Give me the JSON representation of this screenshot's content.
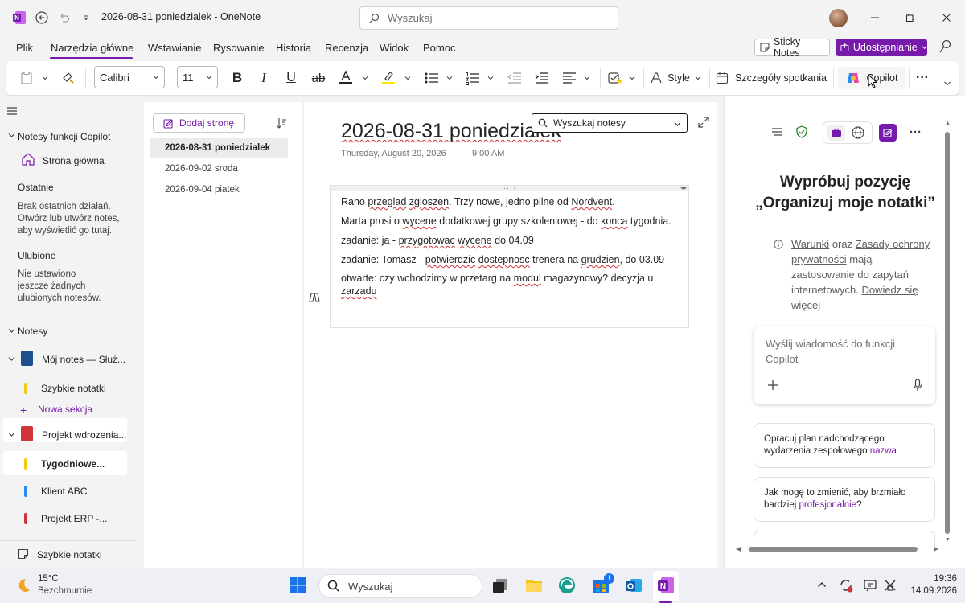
{
  "titlebar": {
    "doc_title": "2026-08-31 poniedzialek  -  OneNote",
    "search_placeholder": "Wyszukaj"
  },
  "menu": {
    "items": [
      "Plik",
      "Narzędzia główne",
      "Wstawianie",
      "Rysowanie",
      "Historia",
      "Recenzja",
      "Widok",
      "Pomoc"
    ],
    "active": "Narzędzia główne",
    "sticky_notes": "Sticky Notes",
    "share": "Udostępnianie"
  },
  "ribbon": {
    "font": "Calibri",
    "size": "11",
    "style_label": "Style",
    "meeting_details": "Szczegóły spotkania",
    "copilot": "Copilot",
    "more": "···"
  },
  "leftnav": {
    "copilot_notebooks": "Notesy funkcji Copilot",
    "home": "Strona główna",
    "recent_head": "Ostatnie",
    "recent_text": "Brak ostatnich działań. Otwórz lub utwórz notes, aby wyświetlić go tutaj.",
    "favorites_head": "Ulubione",
    "favorites_text": "Nie ustawiono jeszcze żadnych ulubionych notesów.",
    "notebooks_head": "Notesy",
    "notebook1": "Mój notes — Służ...",
    "section_quick": "Szybkie notatki",
    "new_section": "Nowa sekcja",
    "notebook2": "Projekt wdrozenia...",
    "section_weekly": "Tygodniowe...",
    "section_client": "Klient ABC",
    "section_erp": "Projekt ERP -...",
    "bottom_quick": "Szybkie notatki"
  },
  "pagelist": {
    "add_page": "Dodaj stronę",
    "pages": [
      "2026-08-31 poniedzialek",
      "2026-09-02 sroda",
      "2026-09-04 piatek"
    ]
  },
  "page": {
    "title": "2026-08-31 poniedzialek",
    "date": "Thursday, August 20, 2026",
    "time": "9:00 AM",
    "search_notes": "Wyszukaj notesy"
  },
  "copilot_pane": {
    "heading": "Wypróbuj pozycję „Organizuj moje notatki”",
    "terms_link1": "Warunki",
    "terms_and": " oraz ",
    "terms_link2": "Zasady ochrony prywatności",
    "terms_mid": " mają zastosowanie do zapytań internetowych. ",
    "terms_link3": "Dowiedz się więcej",
    "input_placeholder": "Wyślij wiadomość do funkcji Copilot",
    "sugg1_text": "Opracuj plan nadchodzącego wydarzenia zespołowego ",
    "sugg1_accent": "nazwa",
    "sugg2_text": "Jak mogę to zmienić, aby brzmiało bardziej ",
    "sugg2_accent": "profesjonalnie",
    "sugg2_end": "?"
  },
  "taskbar": {
    "temp": "15°C",
    "weather": "Bezchmurnie",
    "search": "Wyszukaj",
    "time": "19:36",
    "date": "14.09.2026",
    "badge": "1"
  },
  "colors": {
    "accent": "#7719aa",
    "spell": "#d13438"
  }
}
